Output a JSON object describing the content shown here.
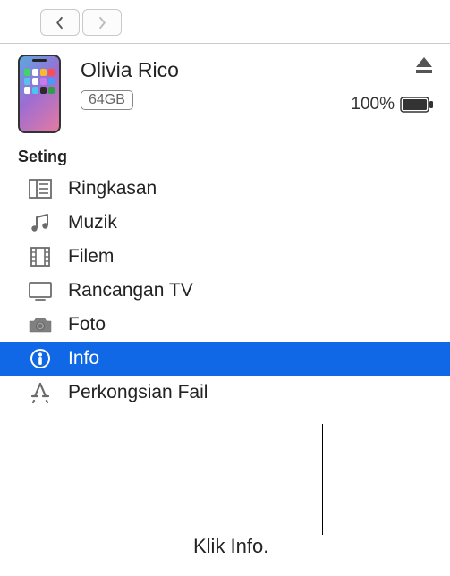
{
  "device": {
    "name": "Olivia Rico",
    "storage": "64GB",
    "battery_pct": "100%"
  },
  "section_label": "Seting",
  "sidebar": {
    "items": [
      {
        "label": "Ringkasan"
      },
      {
        "label": "Muzik"
      },
      {
        "label": "Filem"
      },
      {
        "label": "Rancangan TV"
      },
      {
        "label": "Foto"
      },
      {
        "label": "Info"
      },
      {
        "label": "Perkongsian Fail"
      }
    ]
  },
  "callout": "Klik Info."
}
